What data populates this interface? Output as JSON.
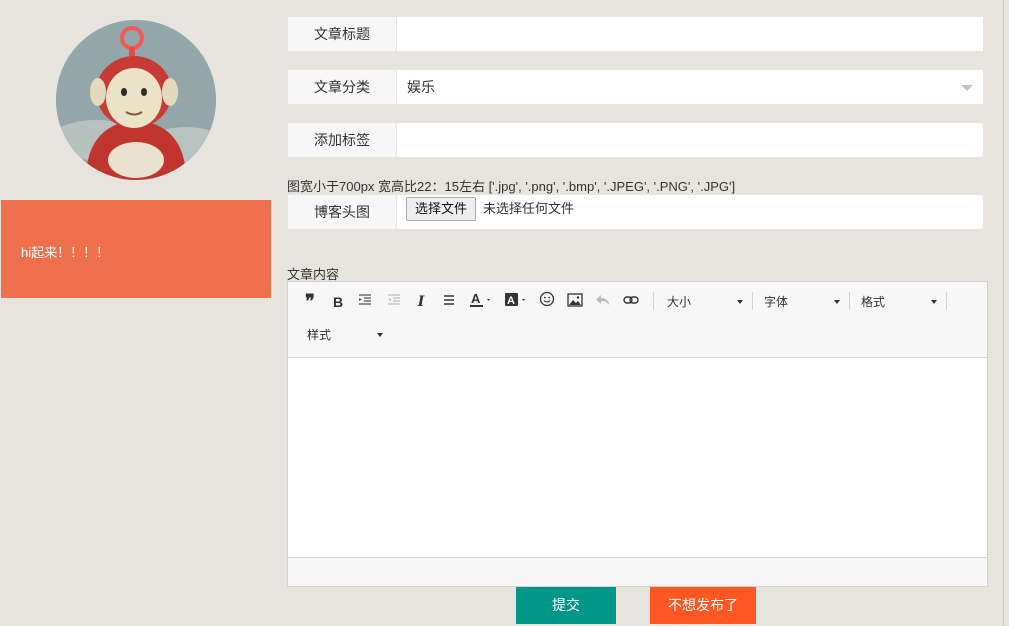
{
  "sidebar": {
    "banner_text": "hi起来！！！！"
  },
  "form": {
    "title_label": "文章标题",
    "title_value": "",
    "category_label": "文章分类",
    "category_value": "娱乐",
    "tags_label": "添加标签",
    "tags_value": "",
    "image_hint": "图宽小于700px 宽高比22：15左右 ['.jpg', '.png', '.bmp', '.JPEG', '.PNG', '.JPG']",
    "cover_label": "博客头图",
    "file_button": "选择文件",
    "file_status": "未选择任何文件",
    "content_label": "文章内容"
  },
  "editor": {
    "tools": [
      "quote-icon",
      "bold-icon",
      "indent-icon",
      "outdent-icon",
      "italic-icon",
      "strikethrough-icon",
      "font-color-icon",
      "background-color-icon",
      "emoji-icon",
      "image-icon",
      "undo-icon",
      "link-icon"
    ],
    "size_label": "大小",
    "font_label": "字体",
    "format_label": "格式",
    "style_label": "样式"
  },
  "actions": {
    "submit": "提交",
    "cancel": "不想发布了"
  },
  "colors": {
    "background": "#e7e4de",
    "banner": "#f0704e",
    "submit": "#009688",
    "cancel": "#ff5722"
  }
}
